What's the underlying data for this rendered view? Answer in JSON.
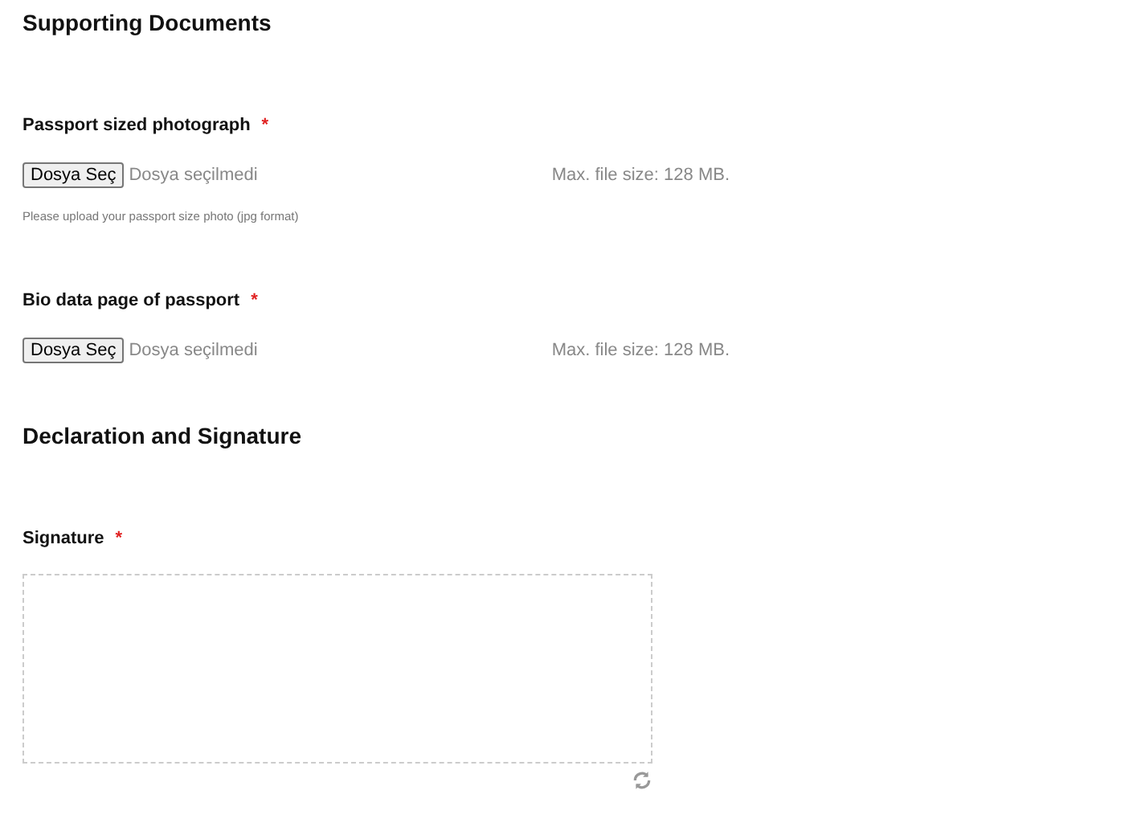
{
  "sections": [
    {
      "title": "Supporting Documents",
      "fields": [
        {
          "kind": "file",
          "label": "Passport sized photograph",
          "required_mark": "*",
          "button": "Dosya Seç",
          "status": "Dosya seçilmedi",
          "max_size": "Max. file size: 128 MB.",
          "help": "Please upload your passport size photo (jpg format)"
        },
        {
          "kind": "file",
          "label": "Bio data page of passport",
          "required_mark": "*",
          "button": "Dosya Seç",
          "status": "Dosya seçilmedi",
          "max_size": "Max. file size: 128 MB."
        }
      ]
    },
    {
      "title": "Declaration and Signature",
      "fields": [
        {
          "kind": "signature",
          "label": "Signature",
          "required_mark": "*"
        }
      ]
    }
  ]
}
